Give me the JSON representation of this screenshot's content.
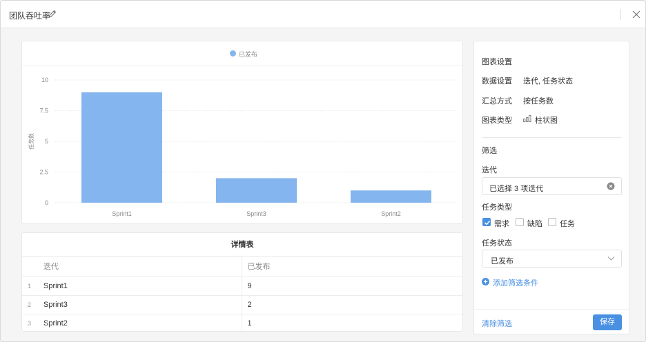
{
  "window": {
    "title": "团队吞吐率"
  },
  "chart_data": {
    "type": "bar",
    "categories": [
      "Sprint1",
      "Sprint3",
      "Sprint2"
    ],
    "series": [
      {
        "name": "已发布",
        "values": [
          9,
          2,
          1
        ],
        "color": "#85b5ee"
      }
    ],
    "ylabel": "任务数",
    "ylim": [
      0,
      10
    ],
    "yticks": [
      "0",
      "2.5",
      "5",
      "7.5",
      "10"
    ],
    "grid": true,
    "legend": "top-center"
  },
  "table": {
    "title": "详情表",
    "columns": [
      "迭代",
      "已发布"
    ],
    "rows": [
      {
        "index": "1",
        "iteration": "Sprint1",
        "released": "9"
      },
      {
        "index": "2",
        "iteration": "Sprint3",
        "released": "2"
      },
      {
        "index": "3",
        "iteration": "Sprint2",
        "released": "1"
      }
    ]
  },
  "settings": {
    "title": "图表设置",
    "data_label": "数据设置",
    "data_value": "迭代, 任务状态",
    "agg_label": "汇总方式",
    "agg_value": "按任务数",
    "type_label": "图表类型",
    "type_value": "柱状图",
    "type_icon": "bar-chart-icon"
  },
  "filter": {
    "title": "筛选",
    "iteration_label": "迭代",
    "iteration_value": "已选择 3 项迭代",
    "task_type_label": "任务类型",
    "task_types": [
      {
        "label": "需求",
        "checked": true
      },
      {
        "label": "缺陷",
        "checked": false
      },
      {
        "label": "任务",
        "checked": false
      }
    ],
    "status_label": "任务状态",
    "status_value": "已发布",
    "add_label": "添加筛选条件"
  },
  "footer": {
    "clear_label": "清除筛选",
    "save_label": "保存"
  },
  "colors": {
    "accent": "#4a90e2",
    "bar": "#85b5ee"
  }
}
